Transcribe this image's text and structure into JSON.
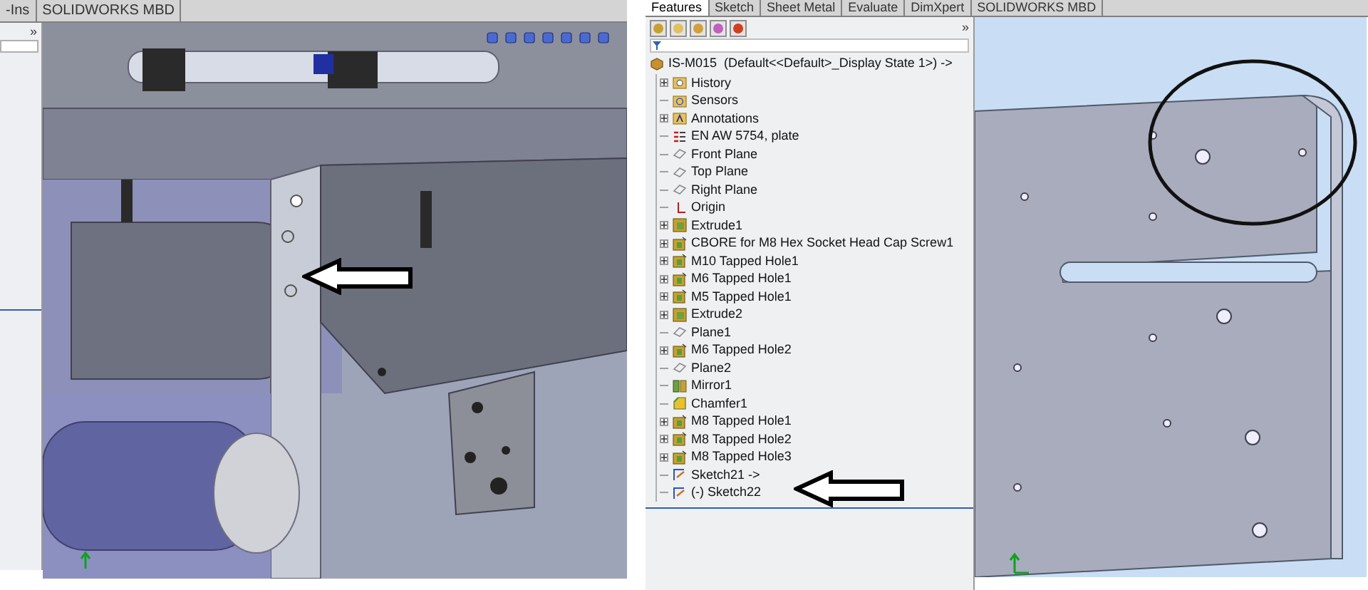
{
  "left_screenshot": {
    "tabs": [
      {
        "label": "-Ins"
      },
      {
        "label": "SOLIDWORKS MBD"
      }
    ],
    "panel": {
      "expand_glyph": "»"
    }
  },
  "right_screenshot": {
    "tabs": [
      {
        "label": "Features",
        "selected": true
      },
      {
        "label": "Sketch",
        "selected": false
      },
      {
        "label": "Sheet Metal",
        "selected": false
      },
      {
        "label": "Evaluate",
        "selected": false
      },
      {
        "label": "DimXpert",
        "selected": false
      },
      {
        "label": "SOLIDWORKS MBD",
        "selected": false
      }
    ],
    "expand_glyph": "»",
    "tree": {
      "root": "IS-M015  (Default<<Default>_Display State 1>) ->",
      "items": [
        {
          "label": "History",
          "kind": "history",
          "expandable": true
        },
        {
          "label": "Sensors",
          "kind": "sensor",
          "expandable": false
        },
        {
          "label": "Annotations",
          "kind": "annotation",
          "expandable": true
        },
        {
          "label": "EN AW 5754, plate",
          "kind": "material",
          "expandable": false
        },
        {
          "label": "Front Plane",
          "kind": "plane",
          "expandable": false
        },
        {
          "label": "Top Plane",
          "kind": "plane",
          "expandable": false
        },
        {
          "label": "Right Plane",
          "kind": "plane",
          "expandable": false
        },
        {
          "label": "Origin",
          "kind": "origin",
          "expandable": false
        },
        {
          "label": "Extrude1",
          "kind": "extrude",
          "expandable": true
        },
        {
          "label": "CBORE for M8 Hex Socket Head Cap Screw1",
          "kind": "hole",
          "expandable": true
        },
        {
          "label": "M10 Tapped Hole1",
          "kind": "hole",
          "expandable": true
        },
        {
          "label": "M6 Tapped Hole1",
          "kind": "hole",
          "expandable": true
        },
        {
          "label": "M5 Tapped Hole1",
          "kind": "hole",
          "expandable": true
        },
        {
          "label": "Extrude2",
          "kind": "extrude",
          "expandable": true
        },
        {
          "label": "Plane1",
          "kind": "plane",
          "expandable": false
        },
        {
          "label": "M6 Tapped Hole2",
          "kind": "hole",
          "expandable": true
        },
        {
          "label": "Plane2",
          "kind": "plane",
          "expandable": false
        },
        {
          "label": "Mirror1",
          "kind": "mirror",
          "expandable": false
        },
        {
          "label": "Chamfer1",
          "kind": "chamfer",
          "expandable": false
        },
        {
          "label": "M8 Tapped Hole1",
          "kind": "hole",
          "expandable": true
        },
        {
          "label": "M8 Tapped Hole2",
          "kind": "hole",
          "expandable": true
        },
        {
          "label": "M8 Tapped Hole3",
          "kind": "hole",
          "expandable": true
        },
        {
          "label": "Sketch21 ->",
          "kind": "sketch",
          "expandable": false
        },
        {
          "label": "(-) Sketch22",
          "kind": "sketch",
          "expandable": false
        }
      ]
    }
  }
}
